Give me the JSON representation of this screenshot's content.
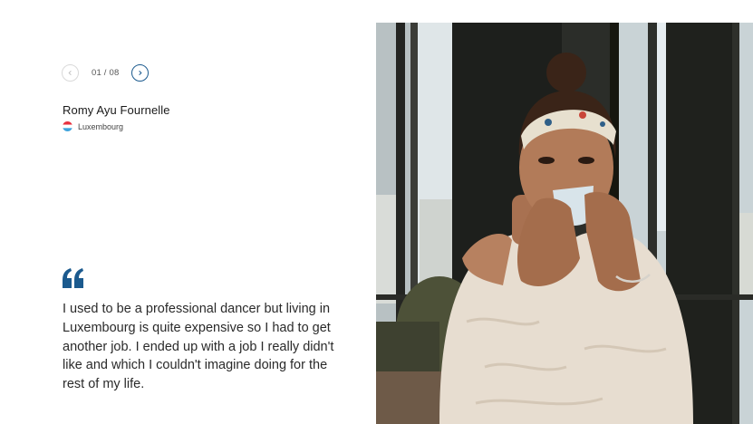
{
  "pager": {
    "counter": "01 / 08",
    "prev_icon": "chevron-left-icon",
    "next_icon": "chevron-right-icon"
  },
  "testimonial": {
    "name": "Romy Ayu Fournelle",
    "country": "Luxembourg",
    "flag_icon": "luxembourg-flag-icon",
    "quote_icon": "quote-icon",
    "quote": "I used to be a professional dancer but living in Luxembourg is quite expensive so I had to get another job. I ended up with a job I really didn't like and which I couldn't imagine doing for the rest of my life."
  },
  "colors": {
    "accent": "#1b5a8e",
    "text": "#2a2a2a",
    "flag_red": "#e8313f",
    "flag_white": "#ffffff",
    "flag_blue": "#3ea3dc"
  },
  "photo": {
    "subject": "woman-drinking-coffee-photo"
  }
}
